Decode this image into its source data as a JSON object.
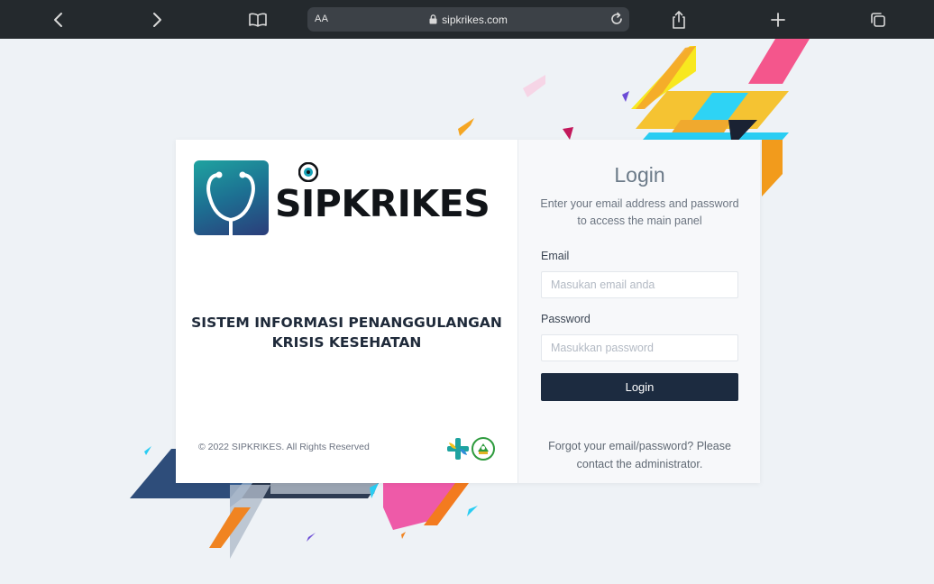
{
  "browser": {
    "url": "sipkrikes.com",
    "reader_label": "AA",
    "icons": [
      "back-icon",
      "forward-icon",
      "bookmarks-icon",
      "lock-icon",
      "reload-icon",
      "share-icon",
      "new-tab-icon",
      "tabs-icon"
    ]
  },
  "brand": {
    "logo_text": "SIPKRIKES",
    "title_line1": "SISTEM INFORMASI PENANGGULANGAN",
    "title_line2": "KRISIS KESEHATAN",
    "copyright": "© 2022 SIPKRIKES. All Rights Reserved",
    "logo_colors": [
      "#1ea3a0",
      "#1d6f92",
      "#2b3d7a"
    ]
  },
  "login": {
    "title": "Login",
    "subtitle": "Enter your email address and password to access the main panel",
    "email_label": "Email",
    "email_placeholder": "Masukan email anda",
    "password_label": "Password",
    "password_placeholder": "Masukkan password",
    "button_label": "Login",
    "forgot_text": "Forgot your email/password? Please contact the administrator.",
    "button_color": "#1c2b40"
  }
}
